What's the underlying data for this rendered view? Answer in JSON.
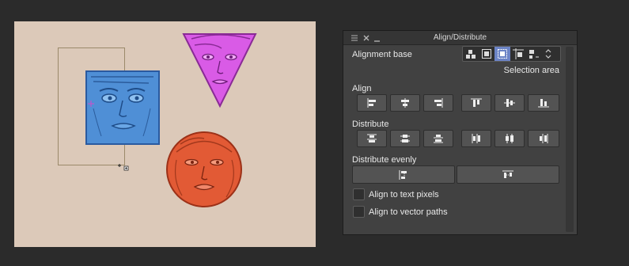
{
  "panel": {
    "title": "Align/Distribute",
    "alignment_base": {
      "label": "Alignment base",
      "selected": "Selection area",
      "options_icons": [
        "align-to-paper-icon",
        "align-to-canvas-icon",
        "align-to-selection-icon",
        "align-to-guide-icon",
        "align-to-key-object-icon"
      ]
    },
    "align": {
      "label": "Align",
      "buttons": [
        "align-left-icon",
        "align-horizontal-center-icon",
        "align-right-icon",
        "align-top-icon",
        "align-vertical-center-icon",
        "align-bottom-icon"
      ]
    },
    "distribute": {
      "label": "Distribute",
      "buttons": [
        "distribute-top-icon",
        "distribute-vertical-center-icon",
        "distribute-bottom-icon",
        "distribute-left-icon",
        "distribute-horizontal-center-icon",
        "distribute-right-icon"
      ]
    },
    "distribute_evenly": {
      "label": "Distribute evenly",
      "buttons": [
        "distribute-evenly-vertical-icon",
        "distribute-evenly-horizontal-icon"
      ]
    },
    "options": [
      {
        "label": "Align to text pixels",
        "checked": false
      },
      {
        "label": "Align to vector paths",
        "checked": false
      }
    ]
  },
  "colors": {
    "canvas_bg": "#dcc9b9",
    "panel_bg": "#414141",
    "active_accent": "#6c84c6",
    "square_face": "#4f8fd6",
    "triangle_face": "#d95be6",
    "circle_face": "#e25a35"
  }
}
